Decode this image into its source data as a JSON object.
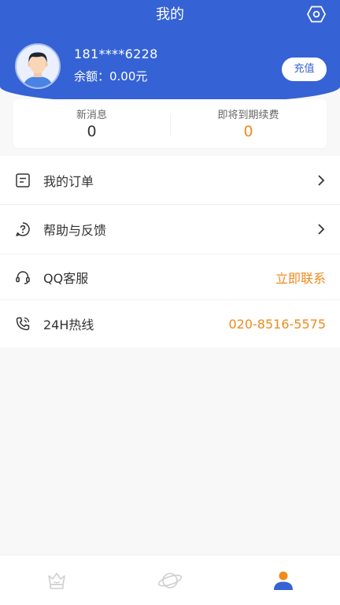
{
  "header": {
    "title": "我的",
    "settings_icon": "settings-hexagon-icon"
  },
  "user": {
    "phone": "181****6228",
    "balance": "余额：0.00元",
    "recharge_label": "充值"
  },
  "stats": [
    {
      "label": "新消息",
      "value": "0"
    },
    {
      "label": "即将到期续费",
      "value": "0"
    }
  ],
  "menu": [
    {
      "icon": "order-list-icon",
      "label": "我的订单",
      "right": ""
    },
    {
      "icon": "help-question-icon",
      "label": "帮助与反馈",
      "right": ""
    },
    {
      "icon": "headset-icon",
      "label": "QQ客服",
      "right": "立即联系"
    },
    {
      "icon": "phone-icon",
      "label": "24H热线",
      "right": "020-8516-5575"
    }
  ],
  "tabs": [
    {
      "icon": "crown-icon",
      "active": false
    },
    {
      "icon": "planet-icon",
      "active": false
    },
    {
      "icon": "user-icon",
      "active": true
    }
  ],
  "colors": {
    "primary": "#3562d5",
    "accent": "#f08a1c",
    "inactive_tab": "#cfcfcf"
  }
}
